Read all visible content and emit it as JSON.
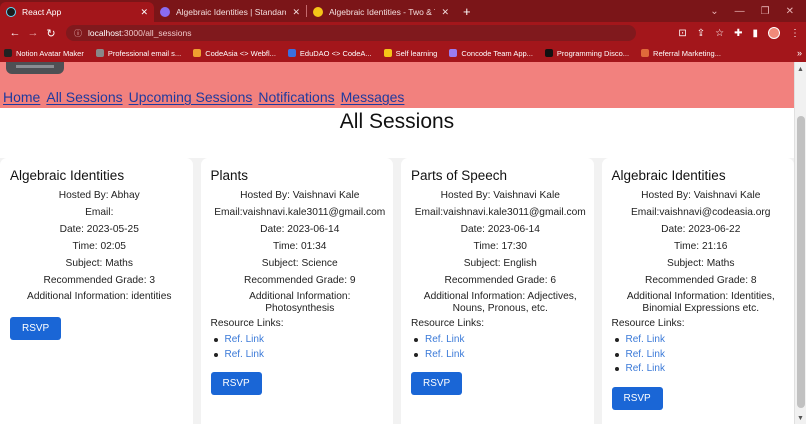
{
  "browser": {
    "tabs": [
      {
        "title": "React App",
        "favicon_color": "#61dafb",
        "active": true
      },
      {
        "title": "Algebraic Identities | Standard Al",
        "favicon_color": "#8a6cf0",
        "active": false
      },
      {
        "title": "Algebraic Identities - Two & Thre",
        "favicon_color": "#f5c518",
        "active": false
      }
    ],
    "new_tab_label": "+",
    "url_host": "localhost",
    "url_path": ":3000/all_sessions",
    "bookmarks": [
      {
        "label": "Notion Avatar Maker",
        "color": "#222222"
      },
      {
        "label": "Professional email s...",
        "color": "#888888"
      },
      {
        "label": "CodeAsia <> Webfl...",
        "color": "#f0a030"
      },
      {
        "label": "EduDAO <> CodeA...",
        "color": "#3b6fe0"
      },
      {
        "label": "Self learning",
        "color": "#f5c518"
      },
      {
        "label": "Concode Team App...",
        "color": "#9a7cf0"
      },
      {
        "label": "Programming Disco...",
        "color": "#111111"
      },
      {
        "label": "Referral Marketing...",
        "color": "#e06a3a"
      }
    ],
    "bookmarks_more": "»"
  },
  "nav": {
    "links": [
      "Home",
      "All Sessions",
      "Upcoming Sessions",
      "Notifications",
      "Messages"
    ]
  },
  "page_title": "All Sessions",
  "sessions": [
    {
      "subject_title": "Algebraic Identities",
      "hosted_by": "Hosted By: Abhay",
      "email": "Email:",
      "date": "Date: 2023-05-25",
      "time": "Time: 02:05",
      "subject": "Subject: Maths",
      "grade": "Recommended Grade: 3",
      "additional": "Additional Information: identities",
      "resource_label": "",
      "resources": [],
      "rsvp_label": "RSVP"
    },
    {
      "subject_title": "Plants",
      "hosted_by": "Hosted By: Vaishnavi Kale",
      "email": "Email:vaishnavi.kale3011@gmail.com",
      "date": "Date: 2023-06-14",
      "time": "Time: 01:34",
      "subject": "Subject: Science",
      "grade": "Recommended Grade: 9",
      "additional": "Additional Information: Photosynthesis",
      "resource_label": "Resource Links:",
      "resources": [
        "Ref. Link",
        "Ref. Link"
      ],
      "rsvp_label": "RSVP"
    },
    {
      "subject_title": "Parts of Speech",
      "hosted_by": "Hosted By: Vaishnavi Kale",
      "email": "Email:vaishnavi.kale3011@gmail.com",
      "date": "Date: 2023-06-14",
      "time": "Time: 17:30",
      "subject": "Subject: English",
      "grade": "Recommended Grade: 6",
      "additional": "Additional Information: Adjectives, Nouns, Pronous, etc.",
      "resource_label": "Resource Links:",
      "resources": [
        "Ref. Link",
        "Ref. Link"
      ],
      "rsvp_label": "RSVP"
    },
    {
      "subject_title": "Algebraic Identities",
      "hosted_by": "Hosted By: Vaishnavi Kale",
      "email": "Email:vaishnavi@codeasia.org",
      "date": "Date: 2023-06-22",
      "time": "Time: 21:16",
      "subject": "Subject: Maths",
      "grade": "Recommended Grade: 8",
      "additional": "Additional Information: Identities, Binomial Expressions etc.",
      "resource_label": "Resource Links:",
      "resources": [
        "Ref. Link",
        "Ref. Link",
        "Ref. Link"
      ],
      "rsvp_label": "RSVP"
    }
  ]
}
